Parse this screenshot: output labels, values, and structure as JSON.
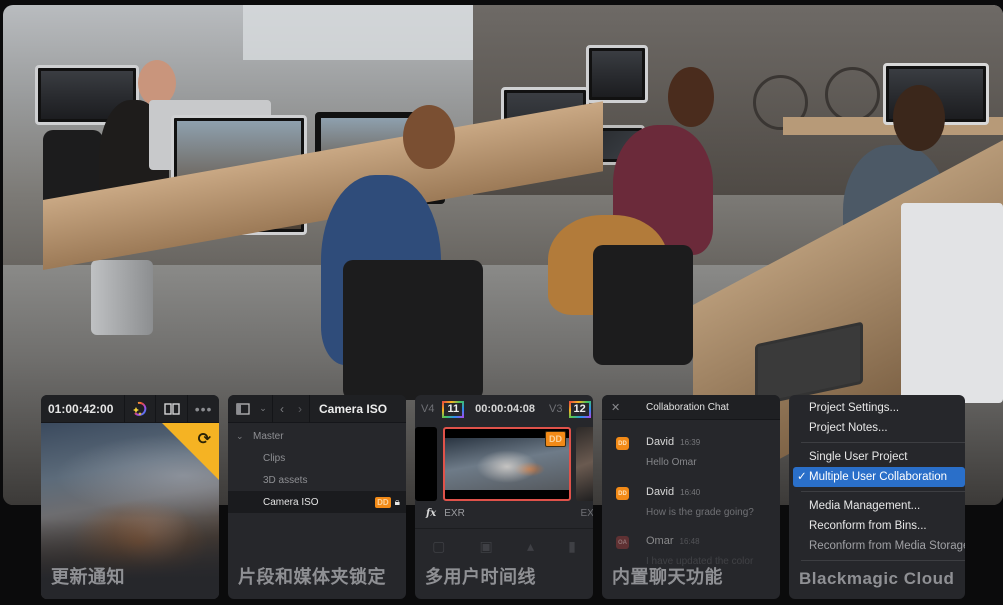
{
  "hero": {
    "description": "Post-production office with editors working at multiple workstations"
  },
  "cards": [
    {
      "id": "update-notifications",
      "title": "更新通知",
      "toolbar": {
        "timecode": "01:00:42:00",
        "icons": [
          "color-magic-icon",
          "dual-viewer-icon",
          "more-options-icon"
        ]
      },
      "corner_icon": "refresh-icon",
      "corner_color": "#f5b323"
    },
    {
      "id": "clip-bin-locking",
      "title": "片段和媒体夹锁定",
      "toolbar": {
        "icons": [
          "sidebar-toggle-icon",
          "chevron-down-icon",
          "back-icon",
          "forward-icon"
        ],
        "bin_title": "Camera ISO"
      },
      "tree": [
        {
          "label": "Master",
          "level": 0,
          "expanded": true
        },
        {
          "label": "Clips",
          "level": 1
        },
        {
          "label": "3D assets",
          "level": 1
        },
        {
          "label": "Camera ISO",
          "level": 1,
          "selected": true,
          "badge": "DD",
          "locked": true
        }
      ]
    },
    {
      "id": "multi-user-timeline",
      "title": "多用户时间线",
      "timeline": {
        "track_a": "V4",
        "clip_a_number": "11",
        "timecode": "00:00:04:08",
        "track_b": "V3",
        "clip_b_number": "12",
        "clip_badge": "DD",
        "clip_a_format": "EXR",
        "clip_b_format": "EXR",
        "fx_label": "fx"
      },
      "accent": "#e0524a"
    },
    {
      "id": "built-in-chat",
      "title": "内置聊天功能",
      "chat": {
        "title": "Collaboration Chat",
        "close_icon": "✕",
        "messages": [
          {
            "initials": "DD",
            "name": "David",
            "time": "16:39",
            "text": "Hello Omar",
            "color": "#f28a17"
          },
          {
            "initials": "DD",
            "name": "David",
            "time": "16:40",
            "text": "How is the grade going?",
            "color": "#f28a17"
          },
          {
            "initials": "OA",
            "name": "Omar",
            "time": "16:48",
            "text": "I have updated the color",
            "color": "#8e3a3a"
          }
        ]
      }
    },
    {
      "id": "blackmagic-cloud",
      "title": "Blackmagic Cloud",
      "menu": {
        "groups": [
          [
            {
              "label": "Project Settings..."
            },
            {
              "label": "Project Notes..."
            }
          ],
          [
            {
              "label": "Single User Project"
            },
            {
              "label": "Multiple User Collaboration",
              "checked": true,
              "selected": true
            }
          ],
          [
            {
              "label": "Media Management..."
            },
            {
              "label": "Reconform from Bins..."
            },
            {
              "label": "Reconform from Media Storage...",
              "disabled": true
            }
          ]
        ],
        "selected_color": "#2a6fc9"
      }
    }
  ]
}
